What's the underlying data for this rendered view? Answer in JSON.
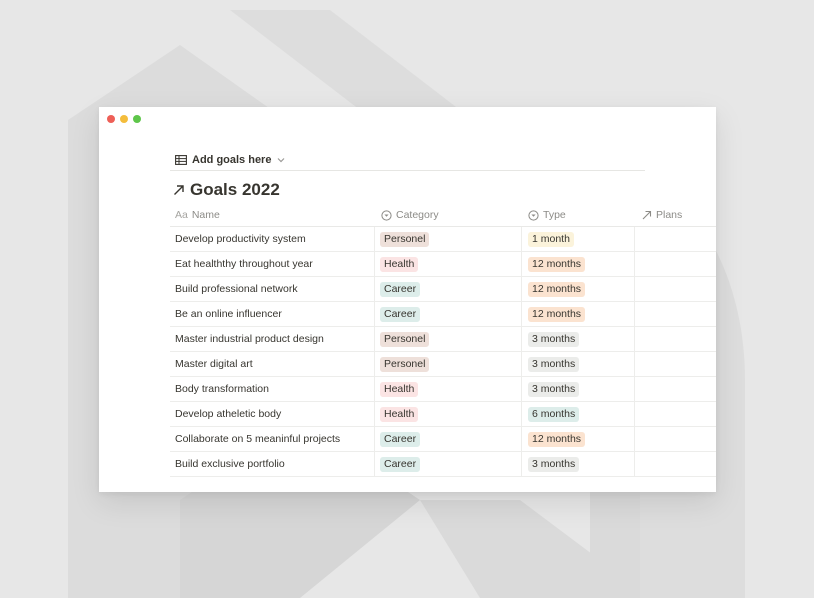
{
  "view": {
    "label": "Add goals here",
    "icon": "table-icon",
    "dropdown_icon": "chevron-down-icon"
  },
  "page": {
    "title": "Goals 2022",
    "icon": "arrow-up-right-icon"
  },
  "columns": [
    {
      "label": "Name",
      "icon": "text-type-icon",
      "icon_text": "Aa"
    },
    {
      "label": "Category",
      "icon": "select-icon"
    },
    {
      "label": "Type",
      "icon": "select-icon"
    },
    {
      "label": "Plans",
      "icon": "relation-arrow-icon"
    }
  ],
  "tag_colors": {
    "Personel": "#eee0da",
    "Health": "#fbe4e4",
    "Career": "#ddedea",
    "1 month": "#fbf3db",
    "12 months": "#fbe3d0",
    "3 months": "#ebecea",
    "6 months": "#ddedea"
  },
  "rows": [
    {
      "name": "Develop productivity system",
      "category": "Personel",
      "type": "1 month"
    },
    {
      "name": "Eat healththy throughout year",
      "category": "Health",
      "type": "12 months"
    },
    {
      "name": "Build professional network",
      "category": "Career",
      "type": "12 months"
    },
    {
      "name": "Be an online influencer",
      "category": "Career",
      "type": "12 months"
    },
    {
      "name": "Master industrial product design",
      "category": "Personel",
      "type": "3 months"
    },
    {
      "name": "Master digital art",
      "category": "Personel",
      "type": "3 months"
    },
    {
      "name": "Body transformation",
      "category": "Health",
      "type": "3 months"
    },
    {
      "name": "Develop atheletic body",
      "category": "Health",
      "type": "6 months"
    },
    {
      "name": "Collaborate on 5 meaninful projects",
      "category": "Career",
      "type": "12 months"
    },
    {
      "name": "Build exclusive portfolio",
      "category": "Career",
      "type": "3 months"
    }
  ]
}
